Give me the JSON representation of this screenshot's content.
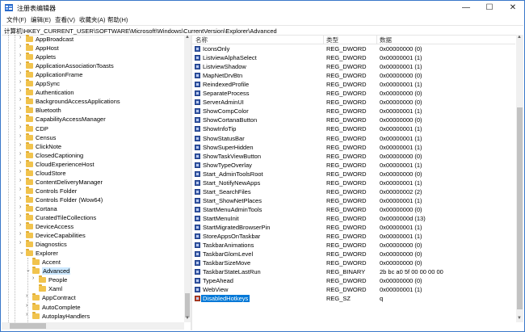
{
  "window": {
    "title": "注册表编辑器",
    "controls": {
      "minimize": "—",
      "maximize": "☐",
      "close": "✕"
    }
  },
  "menu": [
    "文件(F)",
    "编辑(E)",
    "查看(V)",
    "收藏夹(A)",
    "帮助(H)"
  ],
  "address": "计算机\\HKEY_CURRENT_USER\\SOFTWARE\\Microsoft\\Windows\\CurrentVersion\\Explorer\\Advanced",
  "tree": [
    {
      "label": "AppBroadcast",
      "expander": "›",
      "level": 0
    },
    {
      "label": "AppHost",
      "expander": "›",
      "level": 0
    },
    {
      "label": "Applets",
      "expander": "›",
      "level": 0
    },
    {
      "label": "ApplicationAssociationToasts",
      "expander": "›",
      "level": 0
    },
    {
      "label": "ApplicationFrame",
      "expander": "›",
      "level": 0
    },
    {
      "label": "AppSync",
      "expander": "›",
      "level": 0
    },
    {
      "label": "Authentication",
      "expander": "›",
      "level": 0
    },
    {
      "label": "BackgroundAccessApplications",
      "expander": "›",
      "level": 0
    },
    {
      "label": "Bluetooth",
      "expander": "›",
      "level": 0
    },
    {
      "label": "CapabilityAccessManager",
      "expander": "›",
      "level": 0
    },
    {
      "label": "CDP",
      "expander": "›",
      "level": 0
    },
    {
      "label": "Census",
      "expander": "›",
      "level": 0
    },
    {
      "label": "ClickNote",
      "expander": "›",
      "level": 0
    },
    {
      "label": "ClosedCaptioning",
      "expander": "›",
      "level": 0
    },
    {
      "label": "CloudExperienceHost",
      "expander": "›",
      "level": 0
    },
    {
      "label": "CloudStore",
      "expander": "›",
      "level": 0
    },
    {
      "label": "ContentDeliveryManager",
      "expander": "›",
      "level": 0
    },
    {
      "label": "Controls Folder",
      "expander": "›",
      "level": 0
    },
    {
      "label": "Controls Folder (Wow64)",
      "expander": "›",
      "level": 0
    },
    {
      "label": "Cortana",
      "expander": "›",
      "level": 0
    },
    {
      "label": "CuratedTileCollections",
      "expander": "›",
      "level": 0
    },
    {
      "label": "DeviceAccess",
      "expander": "›",
      "level": 0
    },
    {
      "label": "DeviceCapabilities",
      "expander": "›",
      "level": 0
    },
    {
      "label": "Diagnostics",
      "expander": "›",
      "level": 0
    },
    {
      "label": "Explorer",
      "expander": "⌄",
      "level": 0
    },
    {
      "label": "Accent",
      "expander": "",
      "level": 1
    },
    {
      "label": "Advanced",
      "expander": "⌄",
      "level": 1,
      "selected": true
    },
    {
      "label": "People",
      "expander": "›",
      "level": 2
    },
    {
      "label": "Xaml",
      "expander": "",
      "level": 2
    },
    {
      "label": "AppContract",
      "expander": "›",
      "level": 1
    },
    {
      "label": "AutoComplete",
      "expander": "›",
      "level": 1
    },
    {
      "label": "AutoplayHandlers",
      "expander": "›",
      "level": 1
    }
  ],
  "columns": {
    "name": "名称",
    "type": "类型",
    "data": "数据"
  },
  "values": [
    {
      "name": "IconsOnly",
      "type": "REG_DWORD",
      "data": "0x00000000 (0)"
    },
    {
      "name": "ListviewAlphaSelect",
      "type": "REG_DWORD",
      "data": "0x00000001 (1)"
    },
    {
      "name": "ListviewShadow",
      "type": "REG_DWORD",
      "data": "0x00000001 (1)"
    },
    {
      "name": "MapNetDrvBtn",
      "type": "REG_DWORD",
      "data": "0x00000000 (0)"
    },
    {
      "name": "ReindexedProfile",
      "type": "REG_DWORD",
      "data": "0x00000001 (1)"
    },
    {
      "name": "SeparateProcess",
      "type": "REG_DWORD",
      "data": "0x00000000 (0)"
    },
    {
      "name": "ServerAdminUI",
      "type": "REG_DWORD",
      "data": "0x00000000 (0)"
    },
    {
      "name": "ShowCompColor",
      "type": "REG_DWORD",
      "data": "0x00000001 (1)"
    },
    {
      "name": "ShowCortanaButton",
      "type": "REG_DWORD",
      "data": "0x00000000 (0)"
    },
    {
      "name": "ShowInfoTip",
      "type": "REG_DWORD",
      "data": "0x00000001 (1)"
    },
    {
      "name": "ShowStatusBar",
      "type": "REG_DWORD",
      "data": "0x00000001 (1)"
    },
    {
      "name": "ShowSuperHidden",
      "type": "REG_DWORD",
      "data": "0x00000001 (1)"
    },
    {
      "name": "ShowTaskViewButton",
      "type": "REG_DWORD",
      "data": "0x00000000 (0)"
    },
    {
      "name": "ShowTypeOverlay",
      "type": "REG_DWORD",
      "data": "0x00000001 (1)"
    },
    {
      "name": "Start_AdminToolsRoot",
      "type": "REG_DWORD",
      "data": "0x00000000 (0)"
    },
    {
      "name": "Start_NotifyNewApps",
      "type": "REG_DWORD",
      "data": "0x00000001 (1)"
    },
    {
      "name": "Start_SearchFiles",
      "type": "REG_DWORD",
      "data": "0x00000002 (2)"
    },
    {
      "name": "Start_ShowNetPlaces",
      "type": "REG_DWORD",
      "data": "0x00000001 (1)"
    },
    {
      "name": "StartMenuAdminTools",
      "type": "REG_DWORD",
      "data": "0x00000000 (0)"
    },
    {
      "name": "StartMenuInit",
      "type": "REG_DWORD",
      "data": "0x0000000d (13)"
    },
    {
      "name": "StartMigratedBrowserPin",
      "type": "REG_DWORD",
      "data": "0x00000001 (1)"
    },
    {
      "name": "StoreAppsOnTaskbar",
      "type": "REG_DWORD",
      "data": "0x00000001 (1)"
    },
    {
      "name": "TaskbarAnimations",
      "type": "REG_DWORD",
      "data": "0x00000000 (0)"
    },
    {
      "name": "TaskbarGlomLevel",
      "type": "REG_DWORD",
      "data": "0x00000000 (0)"
    },
    {
      "name": "TaskbarSizeMove",
      "type": "REG_DWORD",
      "data": "0x00000000 (0)"
    },
    {
      "name": "TaskbarStateLastRun",
      "type": "REG_BINARY",
      "data": "2b bc a0 5f 00 00 00 00"
    },
    {
      "name": "TypeAhead",
      "type": "REG_DWORD",
      "data": "0x00000000 (0)"
    },
    {
      "name": "WebView",
      "type": "REG_DWORD",
      "data": "0x00000001 (1)"
    },
    {
      "name": "DisabledHotkeys",
      "type": "REG_SZ",
      "data": "q",
      "selected": true
    }
  ],
  "colors": {
    "accent": "#0078d7",
    "folder": "#f1c34d",
    "treeSelection": "#cce8ff"
  }
}
